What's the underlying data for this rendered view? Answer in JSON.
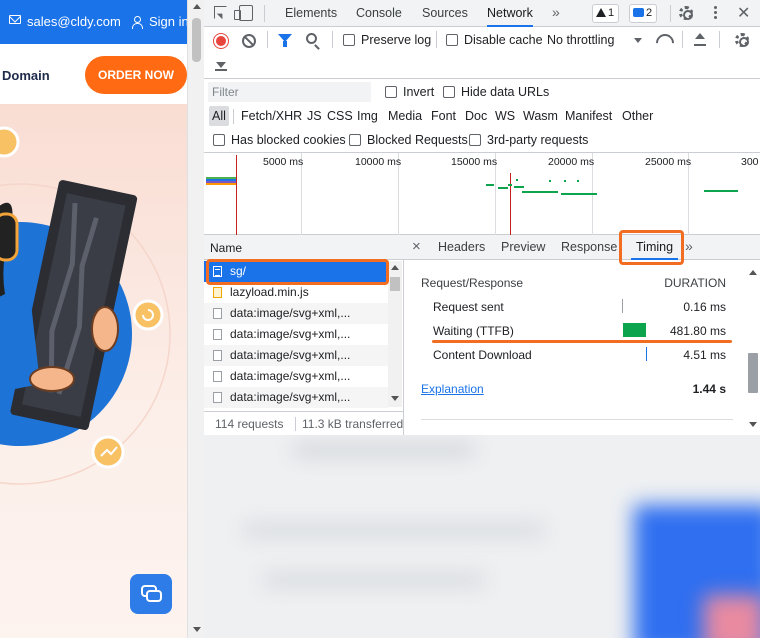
{
  "website": {
    "email": "sales@cldy.com",
    "signin": "Sign in",
    "nav_domain": "Domain",
    "order_button": "ORDER NOW",
    "brand_colors": {
      "primary": "#1a73e8",
      "accent": "#ff6a13"
    }
  },
  "devtools": {
    "tabs": [
      "Elements",
      "Console",
      "Sources",
      "Network"
    ],
    "active_tab": "Network",
    "more_tabs": "»",
    "warnings_count": "1",
    "messages_count": "2",
    "toolbar": {
      "preserve_log": "Preserve log",
      "disable_cache": "Disable cache",
      "throttling": "No throttling"
    },
    "filter": {
      "placeholder": "Filter",
      "invert": "Invert",
      "hide_data_urls": "Hide data URLs",
      "types": [
        "All",
        "Fetch/XHR",
        "JS",
        "CSS",
        "Img",
        "Media",
        "Font",
        "Doc",
        "WS",
        "Wasm",
        "Manifest",
        "Other"
      ],
      "has_blocked_cookies": "Has blocked cookies",
      "blocked_requests": "Blocked Requests",
      "third_party": "3rd-party requests"
    },
    "timeline": {
      "ticks": [
        "5000 ms",
        "10000 ms",
        "15000 ms",
        "20000 ms",
        "25000 ms",
        "300"
      ]
    },
    "requests": {
      "header": "Name",
      "rows": [
        "sg/",
        "lazyload.min.js",
        "data:image/svg+xml,...",
        "data:image/svg+xml,...",
        "data:image/svg+xml,...",
        "data:image/svg+xml,...",
        "data:image/svg+xml,..."
      ],
      "selected": "sg/",
      "count": "114 requests",
      "transferred": "11.3 kB transferred"
    },
    "detail": {
      "close": "×",
      "tabs": [
        "Headers",
        "Preview",
        "Response",
        "Timing"
      ],
      "active_tab": "Timing",
      "more": "»",
      "section": "Request/Response",
      "duration_header": "DURATION",
      "rows": [
        {
          "name": "Request sent",
          "value": "0.16 ms"
        },
        {
          "name": "Waiting (TTFB)",
          "value": "481.80 ms"
        },
        {
          "name": "Content Download",
          "value": "4.51 ms"
        }
      ],
      "explanation": "Explanation",
      "total": "1.44 s",
      "ttfb_color": "#0ca54e",
      "download_color": "#1a73e8"
    },
    "annotation_color": "#f26d21"
  }
}
